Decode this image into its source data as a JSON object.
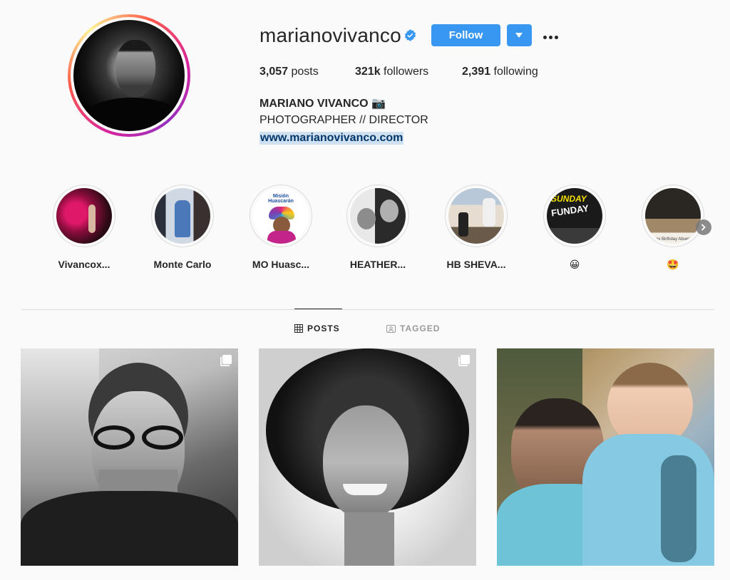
{
  "profile": {
    "username": "marianovivanco",
    "verified": true,
    "follow_label": "Follow",
    "stats": {
      "posts_count": "3,057",
      "posts_label": "posts",
      "followers_count": "321k",
      "followers_label": "followers",
      "following_count": "2,391",
      "following_label": "following"
    },
    "bio": {
      "name": "MARIANO VIVANCO 📷",
      "line": "PHOTOGRAPHER // DIRECTOR",
      "link": "www.marianovivanco.com"
    }
  },
  "highlights": [
    {
      "label": "Vivancox..."
    },
    {
      "label": "Monte Carlo"
    },
    {
      "label": "MO Huasc..."
    },
    {
      "label": "HEATHER..."
    },
    {
      "label": "HB SHEVA..."
    },
    {
      "label": "😀"
    },
    {
      "label": "🤩"
    }
  ],
  "highlight_texts": {
    "mision_line1": "Misión",
    "mision_line2": "Huascarán",
    "funday_top": "SUNDAY",
    "funday_main": "FUNDAY",
    "birthday": "Happy Birthday Abuela"
  },
  "tabs": {
    "posts": "POSTS",
    "tagged": "TAGGED",
    "active": "posts"
  },
  "colors": {
    "primary_button": "#3897f0",
    "link": "#003569",
    "verified_badge": "#3897f0"
  }
}
